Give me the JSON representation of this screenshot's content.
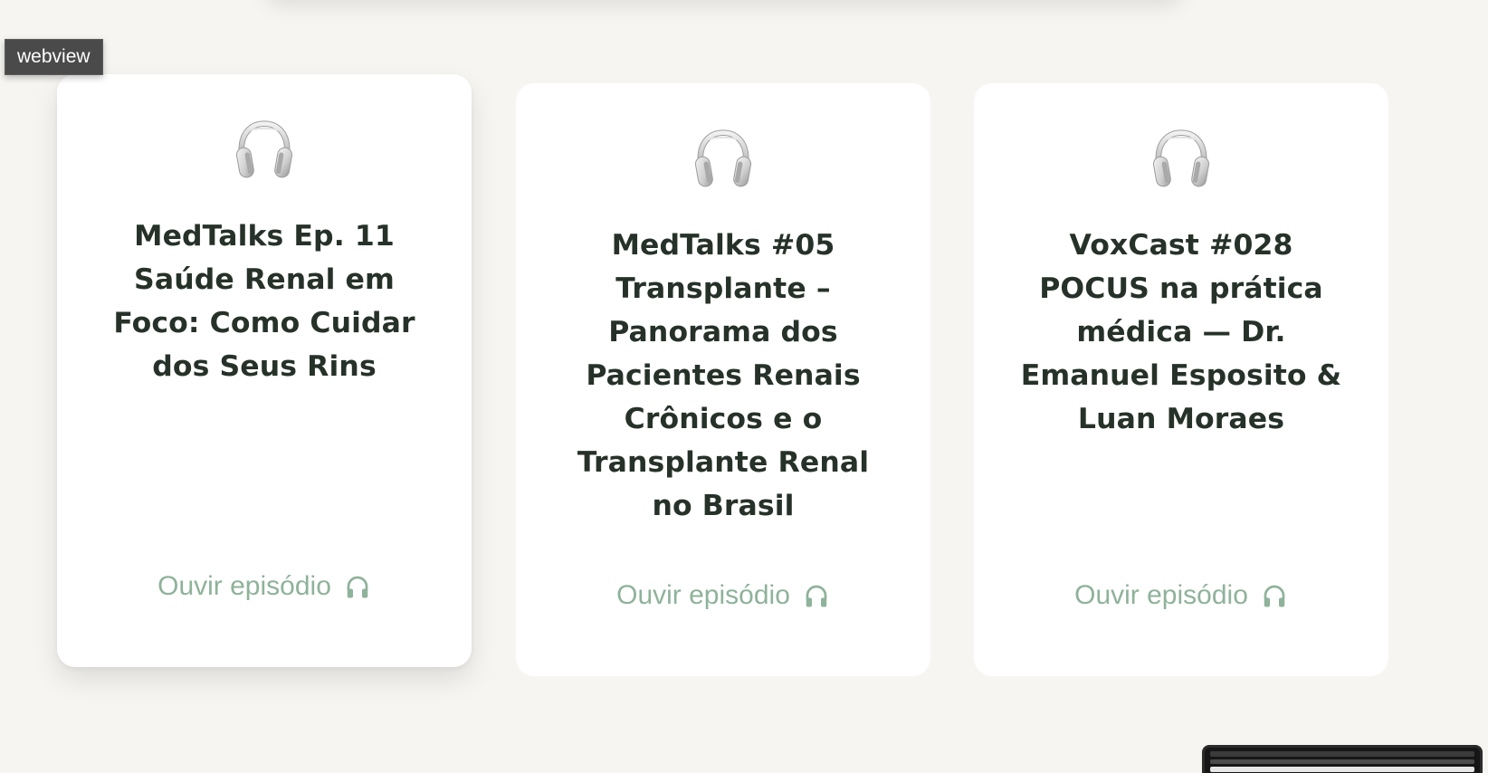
{
  "overlay": {
    "label": "webview"
  },
  "episodes": [
    {
      "title": "MedTalks Ep. 11 Saúde Renal em Foco: Como Cuidar dos Seus Rins",
      "link_label": "Ouvir episódio",
      "icon": "headphones-emoji-icon",
      "link_icon": "headphones-icon"
    },
    {
      "title": "MedTalks #05 Transplante – Panorama dos Pacientes Renais Crônicos e o Transplante Renal no Brasil",
      "link_label": "Ouvir episódio",
      "icon": "headphones-emoji-icon",
      "link_icon": "headphones-icon"
    },
    {
      "title": "VoxCast #028 POCUS na prática médica — Dr. Emanuel Esposito & Luan Moraes",
      "link_label": "Ouvir episódio",
      "icon": "headphones-emoji-icon",
      "link_icon": "headphones-icon"
    }
  ],
  "colors": {
    "background": "#f6f5f2",
    "card": "#ffffff",
    "title": "#263229",
    "link": "#8fb29a"
  }
}
